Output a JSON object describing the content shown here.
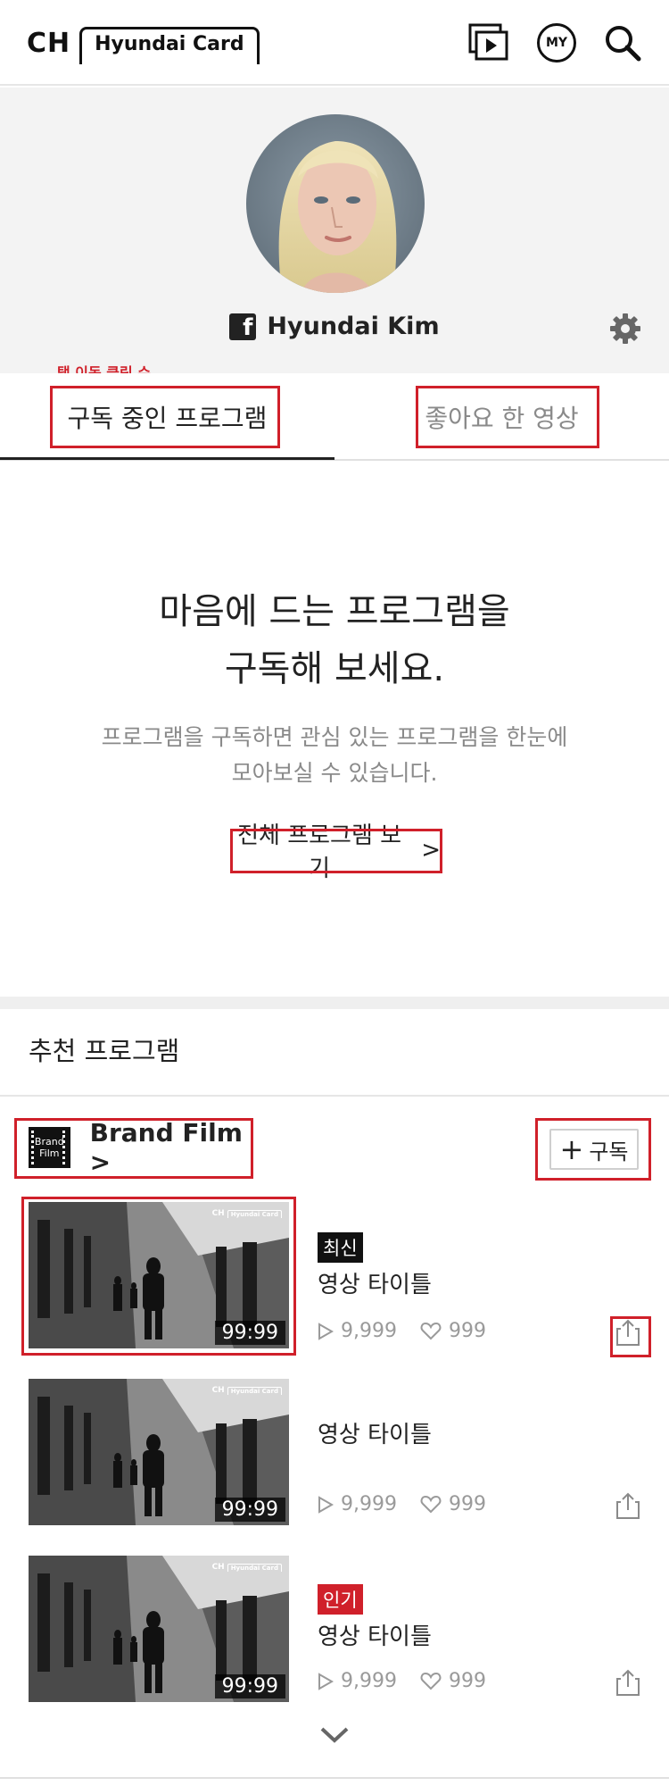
{
  "header": {
    "logo_ch": "CH",
    "logo_brand": "Hyundai Card",
    "my_label": "MY"
  },
  "profile": {
    "name": "Hyundai Kim",
    "social_icon": "facebook-icon"
  },
  "annotation": {
    "tab_note": "탭 이동 클릭 수"
  },
  "tabs": [
    {
      "label": "구독 중인 프로그램",
      "active": true
    },
    {
      "label": "좋아요 한 영상",
      "active": false
    }
  ],
  "empty_state": {
    "title_line1": "마음에 드는 프로그램을",
    "title_line2": "구독해 보세요.",
    "desc_line1": "프로그램을 구독하면 관심 있는 프로그램을 한눈에",
    "desc_line2": "모아보실 수 있습니다.",
    "link_label": "전체 프로그램 보기",
    "link_chevron": ">"
  },
  "recommended": {
    "section_title": "추천 프로그램",
    "program": {
      "logo_line1": "Brand",
      "logo_line2": "Film",
      "name": "Brand Film >",
      "subscribe_plus": "+",
      "subscribe_label": "구독"
    },
    "videos": [
      {
        "badge": "최신",
        "badge_type": "new",
        "title": "영상 타이틀",
        "duration": "99:99",
        "plays": "9,999",
        "likes": "999"
      },
      {
        "badge": "",
        "badge_type": "none",
        "title": "영상 타이틀",
        "duration": "99:99",
        "plays": "9,999",
        "likes": "999"
      },
      {
        "badge": "인기",
        "badge_type": "hot",
        "title": "영상 타이틀",
        "duration": "99:99",
        "plays": "9,999",
        "likes": "999"
      }
    ],
    "thumb_watermark_ch": "CH",
    "thumb_watermark_brand": "Hyundai Card"
  },
  "colors": {
    "accent_red": "#d0202a",
    "text_dark": "#222222",
    "text_muted": "#8a8a8a",
    "profile_bg": "#f3f3f3"
  }
}
